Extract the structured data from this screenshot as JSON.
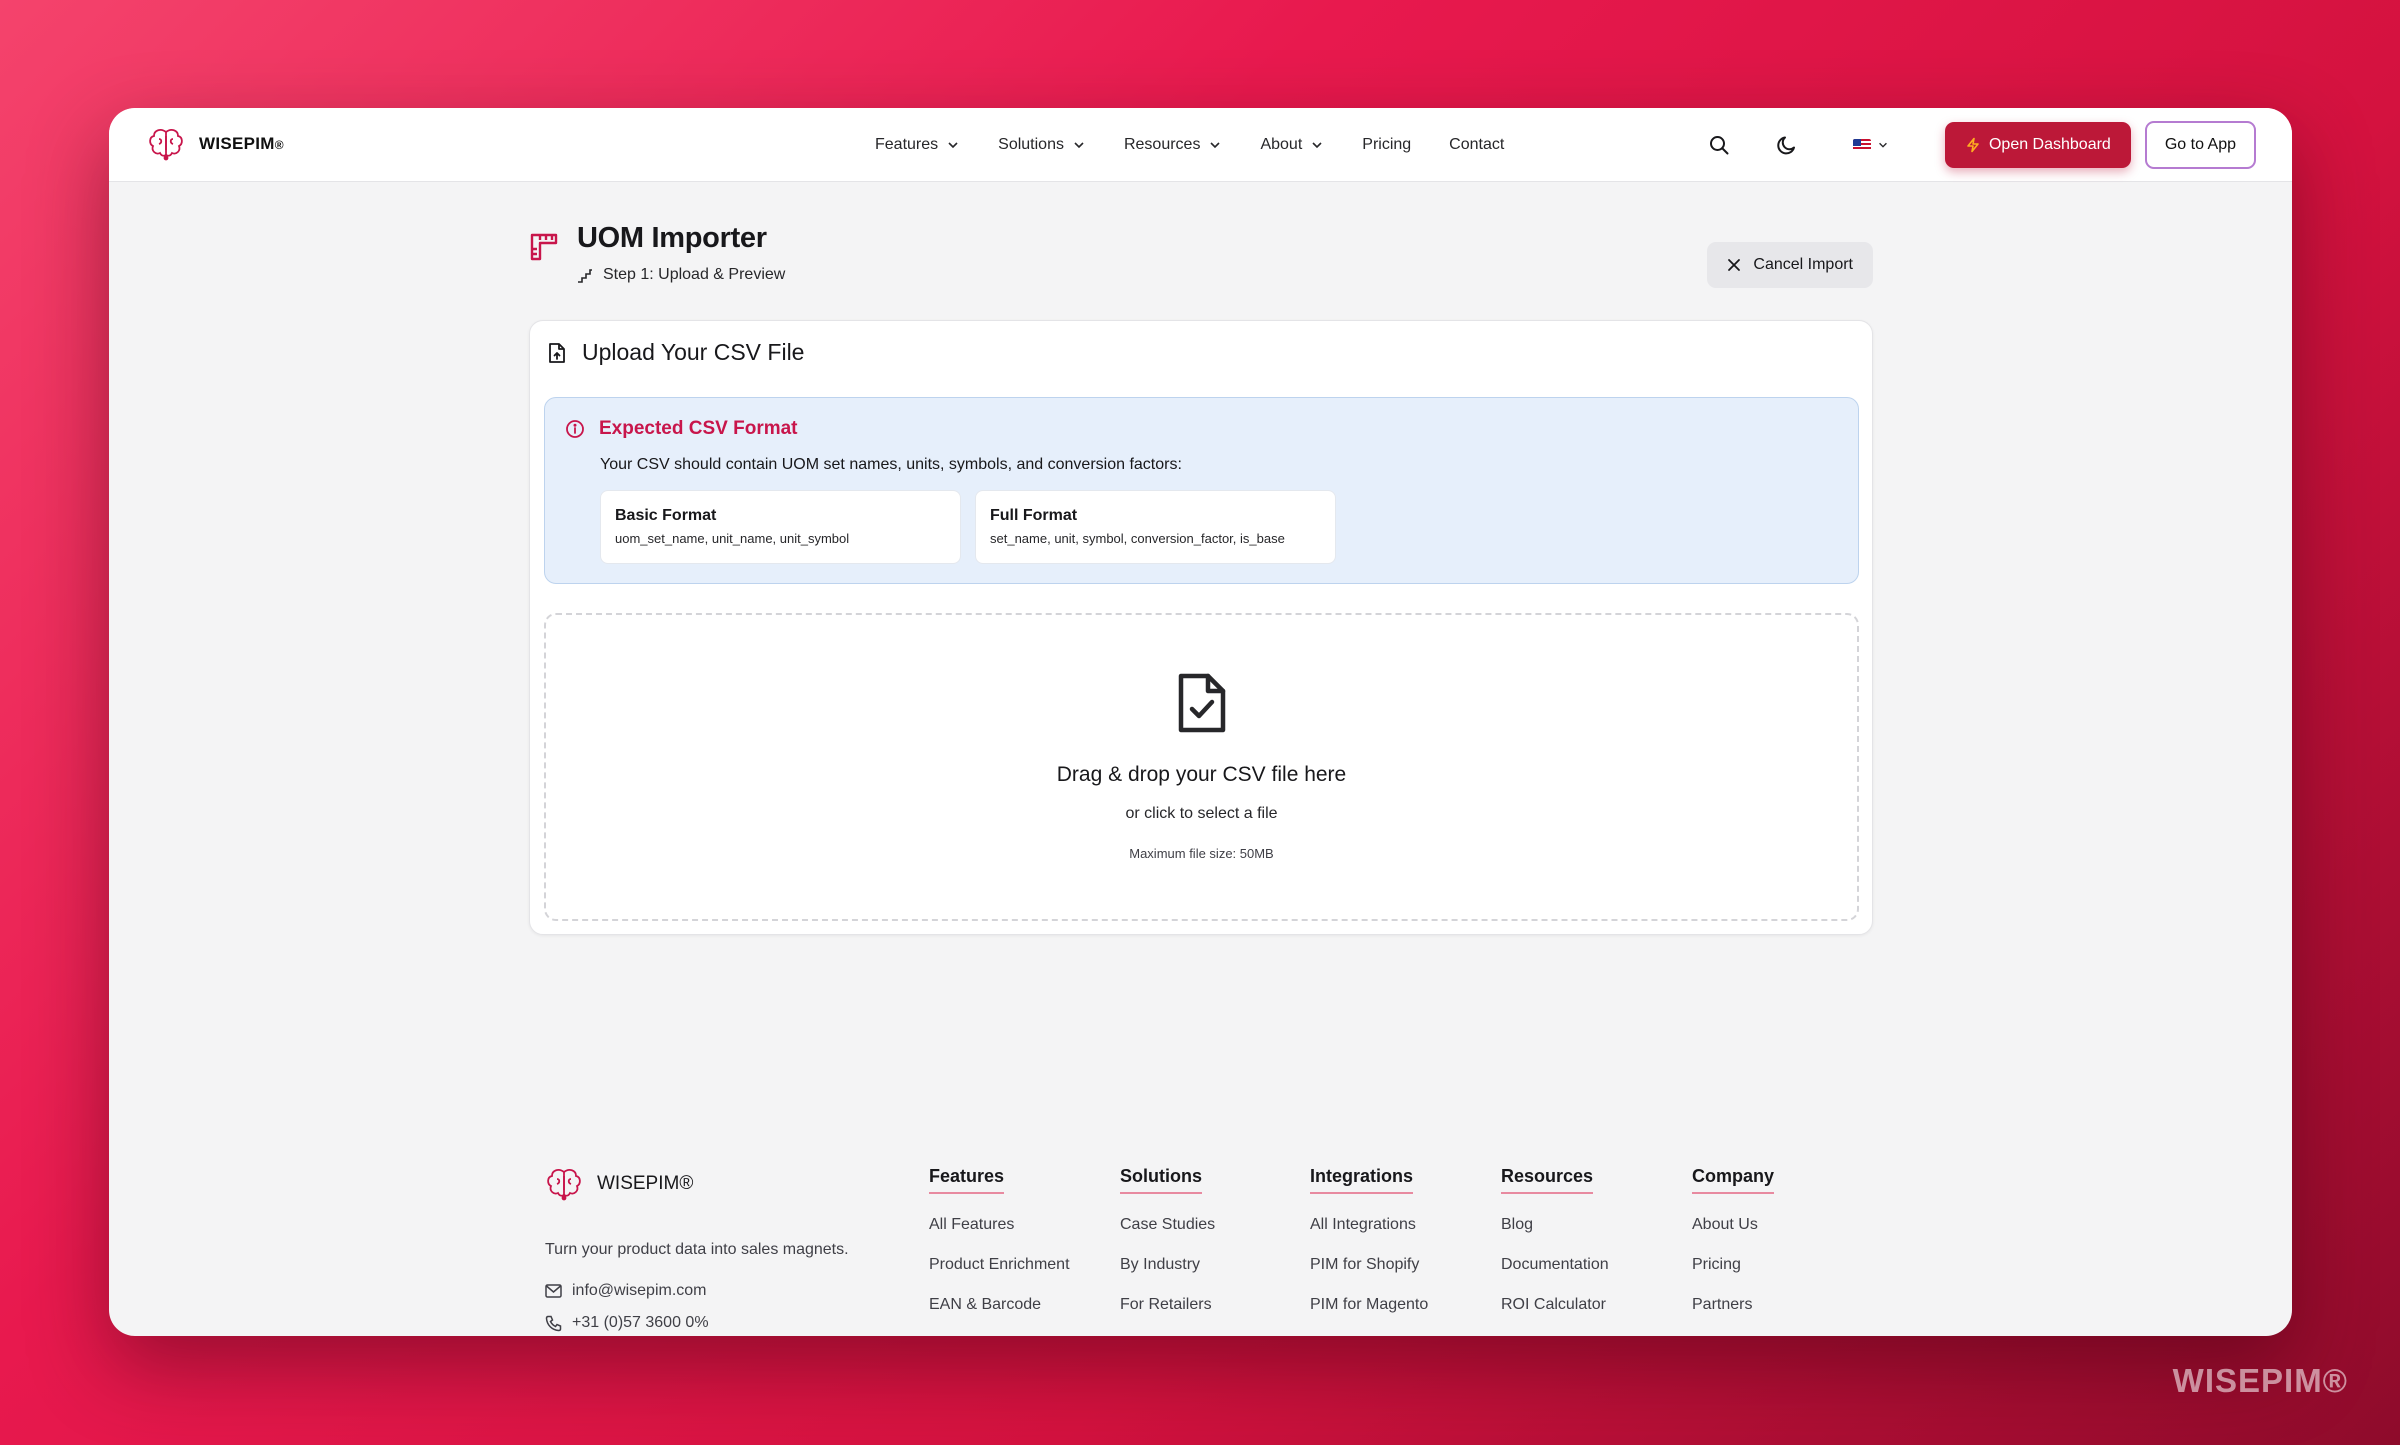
{
  "brand": {
    "name": "WISEPIM",
    "reg": "®",
    "watermark": "WISEPIM®"
  },
  "nav": {
    "links": [
      {
        "label": "Features",
        "has_dropdown": true
      },
      {
        "label": "Solutions",
        "has_dropdown": true
      },
      {
        "label": "Resources",
        "has_dropdown": true
      },
      {
        "label": "About",
        "has_dropdown": true
      },
      {
        "label": "Pricing",
        "has_dropdown": false
      },
      {
        "label": "Contact",
        "has_dropdown": false
      }
    ],
    "dashboard_label": "Open Dashboard",
    "go_app_label": "Go to App",
    "accent_color": "#bc1838"
  },
  "page": {
    "title": "UOM Importer",
    "step": "Step 1: Upload & Preview",
    "cancel_label": "Cancel Import"
  },
  "upload": {
    "card_title": "Upload Your CSV File",
    "info_title": "Expected CSV Format",
    "info_desc": "Your CSV should contain UOM set names, units, symbols, and conversion factors:",
    "formats": [
      {
        "title": "Basic Format",
        "columns": "uom_set_name, unit_name, unit_symbol"
      },
      {
        "title": "Full Format",
        "columns": "set_name, unit, symbol, conversion_factor, is_base"
      }
    ],
    "drop_title": "Drag & drop your CSV file here",
    "drop_sub": "or click to select a file",
    "max_size": "Maximum file size: 50MB"
  },
  "footer": {
    "brand": "WISEPIM®",
    "tagline": "Turn your product data into sales magnets.",
    "email": "info@wisepim.com",
    "phone": "+31 (0)57 3600 0%",
    "columns": [
      {
        "title": "Features",
        "items": [
          "All Features",
          "Product Enrichment",
          "EAN & Barcode"
        ]
      },
      {
        "title": "Solutions",
        "items": [
          "Case Studies",
          "By Industry",
          "For Retailers"
        ]
      },
      {
        "title": "Integrations",
        "items": [
          "All Integrations",
          "PIM for Shopify",
          "PIM for Magento"
        ]
      },
      {
        "title": "Resources",
        "items": [
          "Blog",
          "Documentation",
          "ROI Calculator"
        ]
      },
      {
        "title": "Company",
        "items": [
          "About Us",
          "Pricing",
          "Partners"
        ]
      }
    ]
  }
}
